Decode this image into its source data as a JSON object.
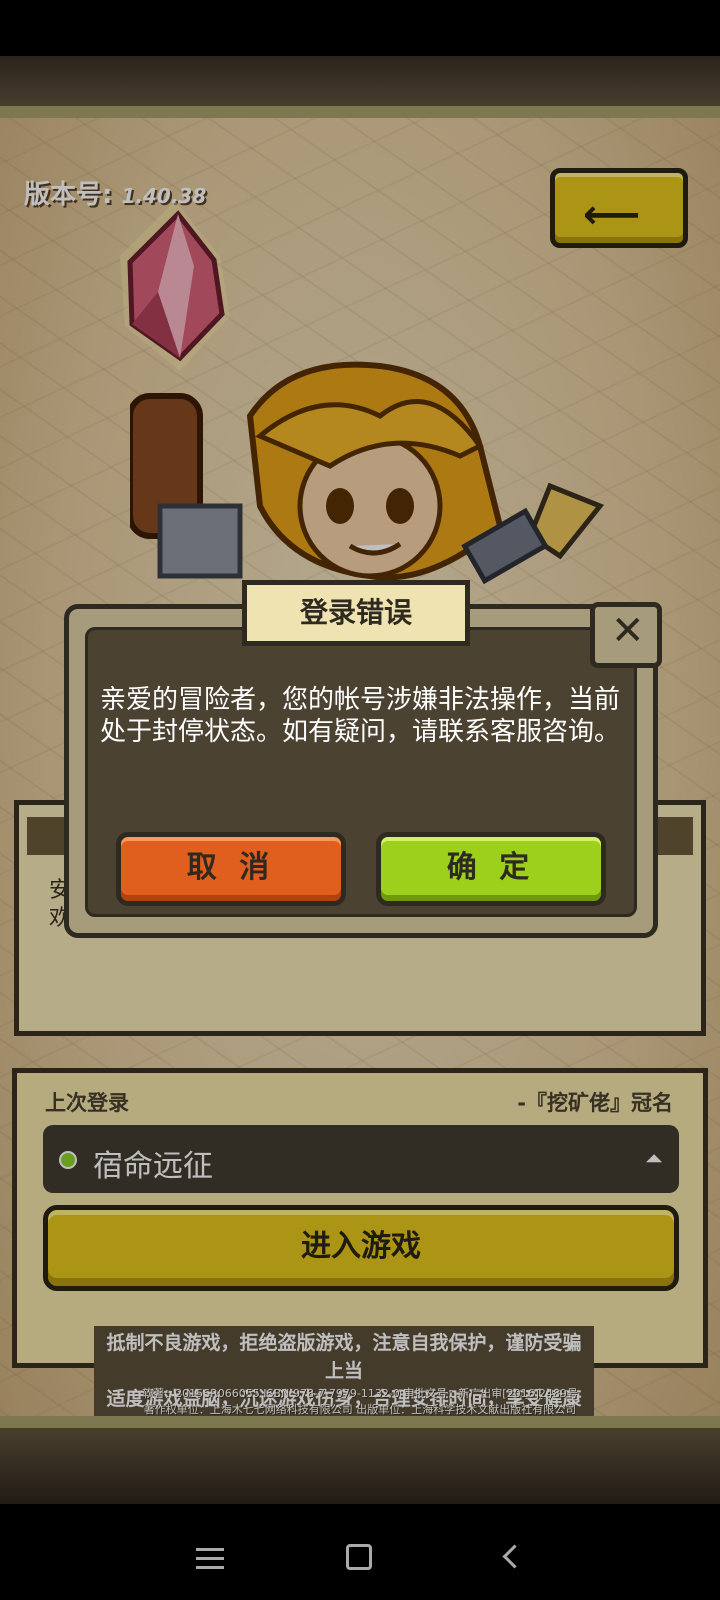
{
  "header": {
    "version_label": "版本号:",
    "version_value": "1.40.38"
  },
  "dialog": {
    "title": "登录错误",
    "message": "亲爱的冒险者，您的帐号涉嫌非法操作，当前处于封停状态。如有疑问，请联系客服咨询。",
    "cancel_label": "取 消",
    "confirm_label": "确 定",
    "close_icon": "✕"
  },
  "panel": {
    "text": "安\n欢"
  },
  "login": {
    "last_login_label": "上次登录",
    "sponsor": "-『挖矿佬』冠名",
    "server_name": "宿命远征",
    "enter_label": "进入游戏",
    "status_color": "#8dd42a"
  },
  "notice": {
    "warning_line1": "抵制不良游戏，拒绝盗版游戏，注意自我保护，谨防受骗上当",
    "warning_line2": "适度游戏益脑，沉迷游戏伤身，合理安排时间，享受健康生活",
    "legal_line1": "软著：2015SR066055  ISBN:978-7-7979-1132-0  审批文号：新广出审[2016]2489号",
    "legal_line2": "著作权单位：上海木七七网络科技有限公司  出版单位：上海科学技术文献出版社有限公司"
  },
  "icons": {
    "back": "arrow-left-icon",
    "close": "close-icon",
    "caret": "caret-up-icon"
  }
}
